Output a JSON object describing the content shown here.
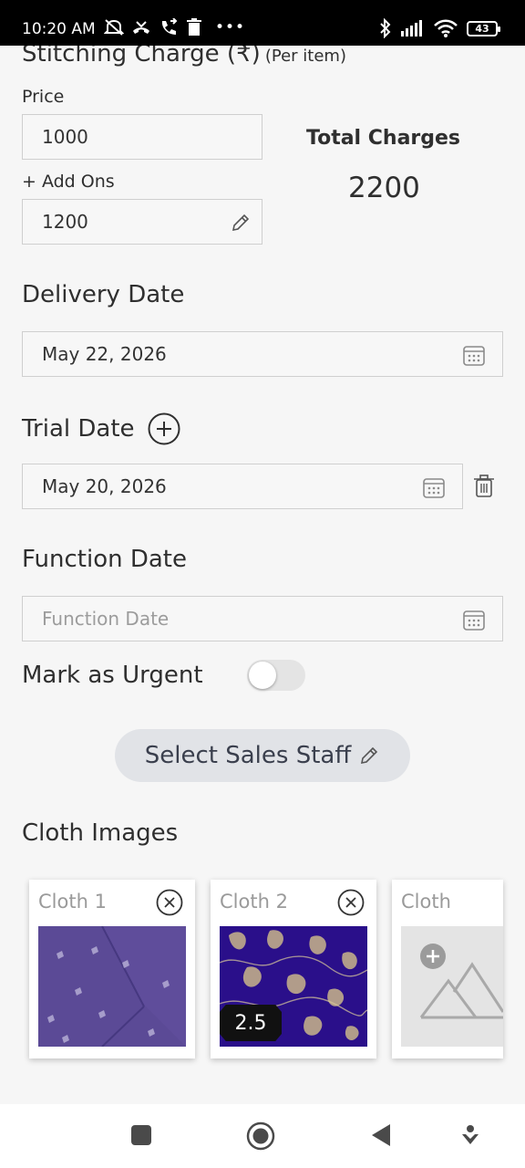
{
  "status_bar": {
    "time": "10:20 AM",
    "battery": "43"
  },
  "stitching": {
    "title": "Stitching Charge (₹)",
    "subtitle": "(Per item)"
  },
  "price": {
    "label": "Price",
    "value": "1000"
  },
  "addons": {
    "label": "+ Add Ons",
    "value": "1200"
  },
  "total": {
    "title": "Total Charges",
    "value": "2200"
  },
  "delivery": {
    "title": "Delivery Date",
    "value": "May 22, 2026"
  },
  "trial": {
    "title": "Trial Date",
    "value": "May 20, 2026"
  },
  "function": {
    "title": "Function Date",
    "placeholder": "Function Date"
  },
  "urgent": {
    "label": "Mark as Urgent",
    "enabled": false
  },
  "staff_button": {
    "label": "Select Sales Staff"
  },
  "cloth_images": {
    "title": "Cloth Images",
    "cards": [
      {
        "label": "Cloth 1"
      },
      {
        "label": "Cloth 2",
        "badge": "2.5"
      },
      {
        "label": "Cloth"
      }
    ]
  },
  "colors": {
    "accent_bg": "#e1e3e7",
    "border": "#cfcfcf",
    "fabric_purple": "#5b4a96",
    "fabric_navy": "#2a0f8a"
  },
  "icons": [
    "edit-icon",
    "calendar-icon",
    "add-circle-icon",
    "delete-icon",
    "close-circle-icon",
    "add-image-icon"
  ]
}
